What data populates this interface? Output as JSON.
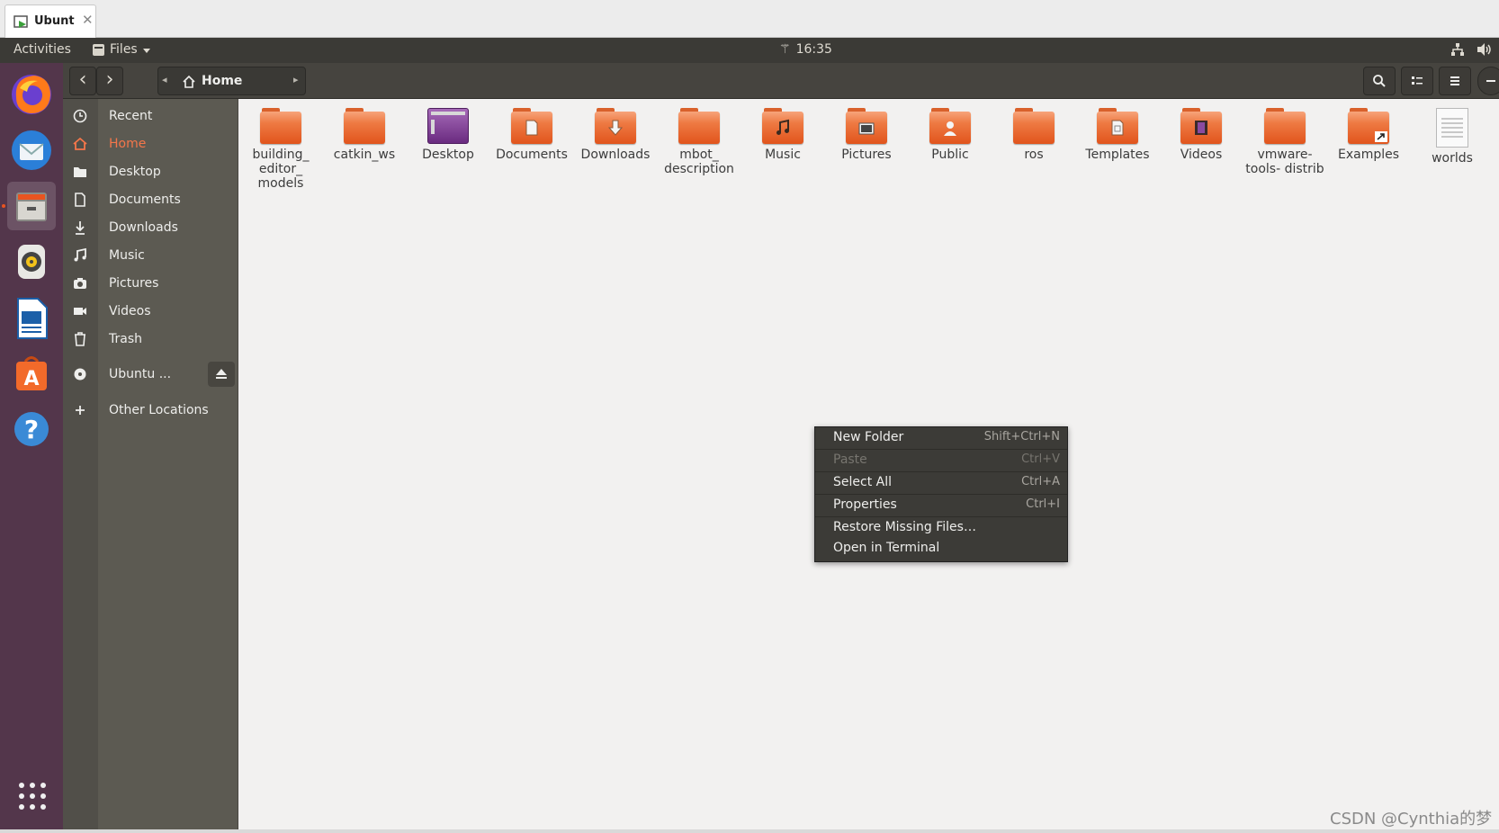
{
  "vm_tab": {
    "label": "Ubunt",
    "close": "✕"
  },
  "top_panel": {
    "activities": "Activities",
    "app_menu": "Files",
    "clock": "16:35",
    "clock_glyph": "⚚"
  },
  "dock": {
    "items": [
      "firefox-icon",
      "thunderbird-icon",
      "files-icon",
      "rhythmbox-icon",
      "libreoffice-writer-icon",
      "ubuntu-software-icon",
      "help-icon"
    ],
    "active_index": 2
  },
  "headerbar": {
    "back": "‹",
    "forward": "›",
    "path_left": "◂",
    "path_right": "▸",
    "location": "Home",
    "search_icon": "search-icon",
    "view_icon": "view-options-icon",
    "menu_icon": "menu-icon"
  },
  "sidebar": {
    "items": [
      {
        "label": "Recent",
        "icon": "recent-icon"
      },
      {
        "label": "Home",
        "icon": "home-icon",
        "active": true
      },
      {
        "label": "Desktop",
        "icon": "folder-icon"
      },
      {
        "label": "Documents",
        "icon": "document-icon"
      },
      {
        "label": "Downloads",
        "icon": "download-icon"
      },
      {
        "label": "Music",
        "icon": "music-icon"
      },
      {
        "label": "Pictures",
        "icon": "camera-icon"
      },
      {
        "label": "Videos",
        "icon": "video-icon"
      },
      {
        "label": "Trash",
        "icon": "trash-icon"
      }
    ],
    "drive": {
      "label": "Ubuntu ...",
      "icon": "disc-icon"
    },
    "other": {
      "label": "Other Locations",
      "icon": "plus-icon"
    }
  },
  "files": [
    {
      "name": "building_ editor_ models",
      "kind": "folder"
    },
    {
      "name": "catkin_ws",
      "kind": "folder"
    },
    {
      "name": "Desktop",
      "kind": "desktop"
    },
    {
      "name": "Documents",
      "kind": "folder",
      "emblem": "document"
    },
    {
      "name": "Downloads",
      "kind": "folder",
      "emblem": "download"
    },
    {
      "name": "mbot_ description",
      "kind": "folder"
    },
    {
      "name": "Music",
      "kind": "folder",
      "emblem": "music"
    },
    {
      "name": "Pictures",
      "kind": "folder",
      "emblem": "pictures"
    },
    {
      "name": "Public",
      "kind": "folder",
      "emblem": "public"
    },
    {
      "name": "ros",
      "kind": "folder"
    },
    {
      "name": "Templates",
      "kind": "folder",
      "emblem": "templates"
    },
    {
      "name": "Videos",
      "kind": "folder",
      "emblem": "videos"
    },
    {
      "name": "vmware- tools- distrib",
      "kind": "folder"
    },
    {
      "name": "Examples",
      "kind": "folder",
      "emblem": "link"
    },
    {
      "name": "worlds",
      "kind": "file"
    }
  ],
  "context_menu": {
    "items": [
      {
        "label": "New Folder",
        "accel": "Shift+Ctrl+N"
      },
      {
        "label": "Paste",
        "accel": "Ctrl+V",
        "disabled": true
      },
      {
        "label": "Select All",
        "accel": "Ctrl+A"
      },
      {
        "label": "Properties",
        "accel": "Ctrl+I"
      },
      {
        "label": "Restore Missing Files…",
        "accel": ""
      },
      {
        "label": "Open in Terminal",
        "accel": ""
      }
    ]
  },
  "watermark": "CSDN @Cynthia的梦",
  "colors": {
    "accent": "#e95420",
    "dock_bg": "#53364b",
    "sidebar_bg": "#5c5a52",
    "content_bg": "#f2f1f0",
    "panel_bg": "#3b3a36"
  }
}
